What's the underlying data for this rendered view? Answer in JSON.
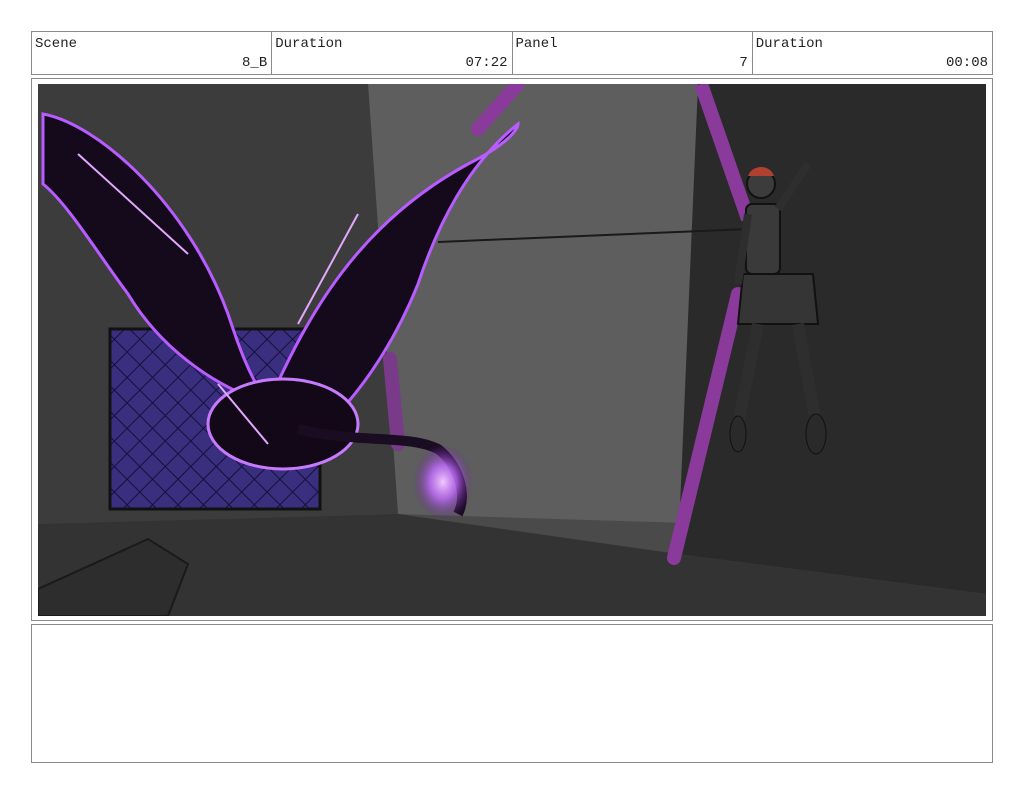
{
  "header": {
    "scene": {
      "label": "Scene",
      "value": "8_B"
    },
    "scene_duration": {
      "label": "Duration",
      "value": "07:22"
    },
    "panel": {
      "label": "Panel",
      "value": "7"
    },
    "panel_duration": {
      "label": "Duration",
      "value": "00:08"
    }
  },
  "colors": {
    "background": "#3a3a3a",
    "wall_light": "#5a5a5a",
    "wall_dark": "#2a2a2a",
    "accent_purple": "#8a3a9a",
    "glow_purple": "#c87aff",
    "net_blue": "#3a2e7e"
  },
  "notes": {
    "text": ""
  }
}
